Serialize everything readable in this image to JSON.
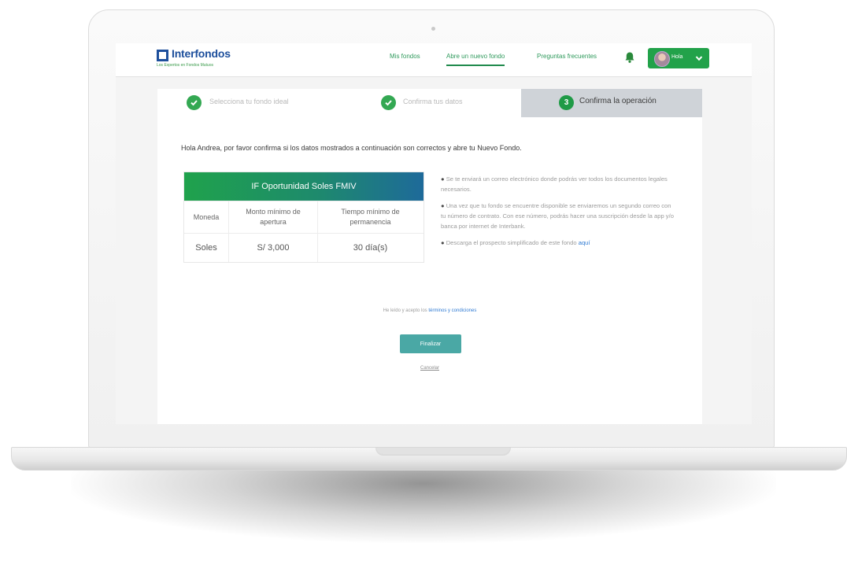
{
  "brand": {
    "name": "Interfondos",
    "tagline": "Los Expertos en Fondos Mutuos",
    "color": "#1d4f9c"
  },
  "nav": {
    "links": [
      {
        "label": "Mis fondos"
      },
      {
        "label": "Abre un nuevo fondo",
        "active": true
      },
      {
        "label": "Preguntas frecuentes"
      }
    ],
    "bell_icon": "bell-icon",
    "user": {
      "name": "Hola",
      "chevron_icon": "chevron-down-icon"
    },
    "accent": "#22a24a"
  },
  "steps": [
    {
      "label": "Selecciona tu fondo ideal",
      "state": "done"
    },
    {
      "label": "Confirma tus datos",
      "state": "done"
    },
    {
      "number": "3",
      "label": "Confirma la operación",
      "state": "current"
    }
  ],
  "greeting": "Hola Andrea, por favor confirma si los datos mostrados a continuación son correctos y abre tu Nuevo Fondo.",
  "fund": {
    "name": "IF Oportunidad Soles FMIV",
    "columns": [
      "Moneda",
      "Monto mínimo de apertura",
      "Tiempo mínimo de permanencia"
    ],
    "values": [
      "Soles",
      "S/ 3,000",
      "30 día(s)"
    ]
  },
  "notes": {
    "note1": "Se te enviará un correo electrónico donde podrás ver todos los documentos legales necesarios.",
    "note2": "Una vez que tu fondo se encuentre disponible se enviaremos un segundo correo con tu número de contrato. Con ese número, podrás hacer una suscripción desde la app y/o banca por internet de Interbank.",
    "note3_text": "Descarga el prospecto simplificado de este fondo ",
    "note3_link": "aquí"
  },
  "terms": {
    "text": "He leído y acepto los ",
    "link": "términos y condiciones"
  },
  "actions": {
    "finish": "Finalizar",
    "cancel": "Cancelar"
  }
}
